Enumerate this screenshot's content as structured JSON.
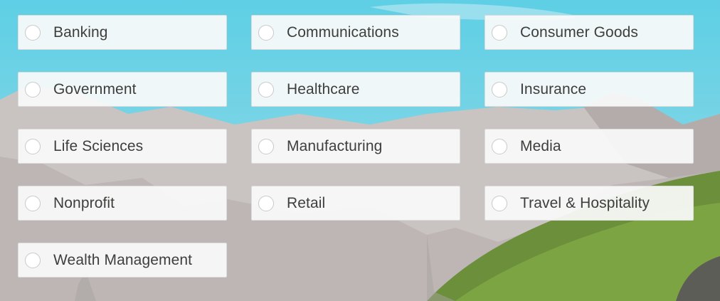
{
  "industries": [
    {
      "label": "Banking",
      "selected": false
    },
    {
      "label": "Communications",
      "selected": false
    },
    {
      "label": "Consumer Goods",
      "selected": false
    },
    {
      "label": "Government",
      "selected": false
    },
    {
      "label": "Healthcare",
      "selected": false
    },
    {
      "label": "Insurance",
      "selected": false
    },
    {
      "label": "Life Sciences",
      "selected": false
    },
    {
      "label": "Manufacturing",
      "selected": false
    },
    {
      "label": "Media",
      "selected": false
    },
    {
      "label": "Nonprofit",
      "selected": false
    },
    {
      "label": "Retail",
      "selected": false
    },
    {
      "label": "Travel & Hospitality",
      "selected": false
    },
    {
      "label": "Wealth Management",
      "selected": false
    }
  ],
  "colors": {
    "sky": "#7fd0e0",
    "mountain": "#c8c2c0",
    "grass": "#6e8f3a",
    "tile_bg": "#fafafa",
    "tile_border": "#dcdcdc",
    "text": "#3e3e3c"
  }
}
